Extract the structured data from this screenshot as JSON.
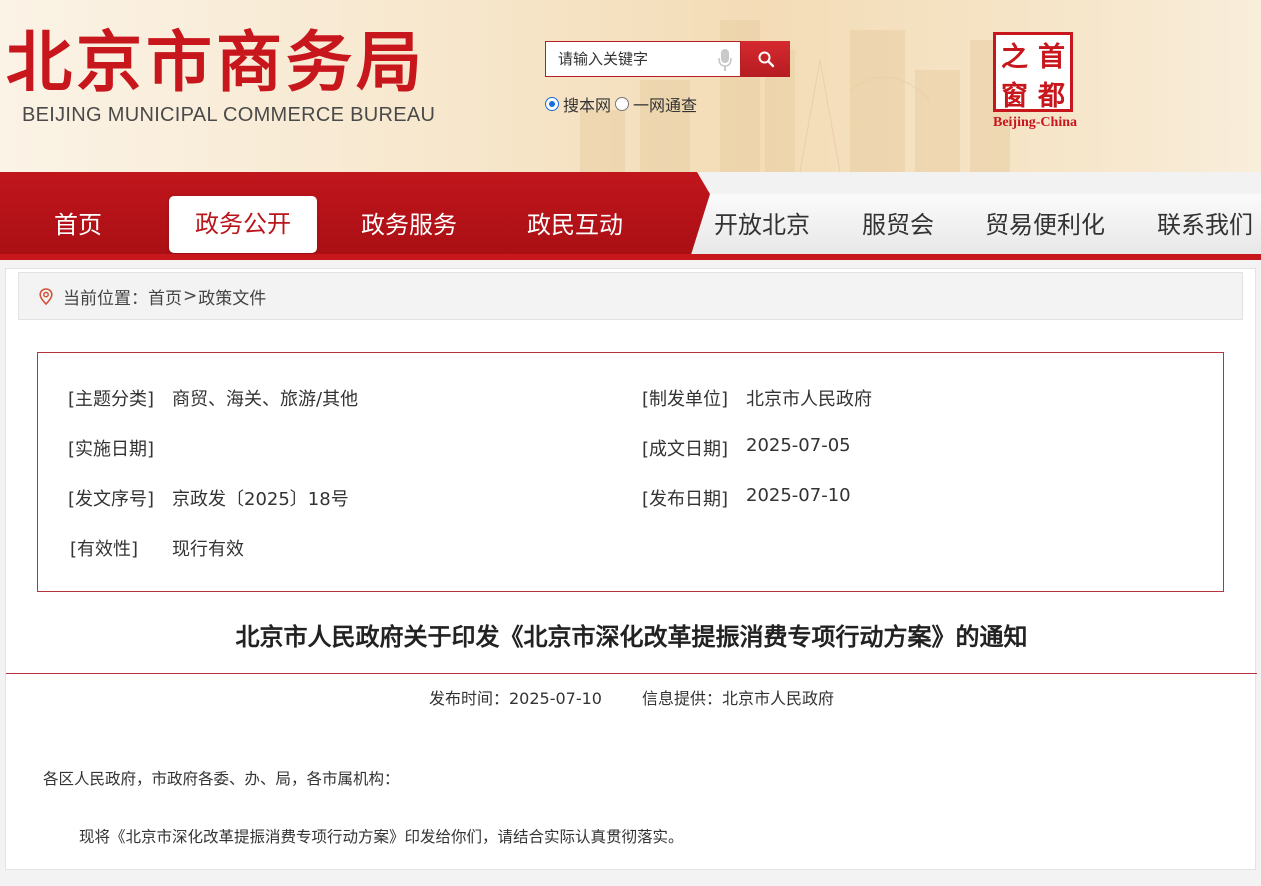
{
  "header": {
    "logo_cn": "北京市商务局",
    "logo_en": "BEIJING MUNICIPAL COMMERCE BUREAU",
    "search": {
      "placeholder": "请输入关键字"
    },
    "scope_options": [
      {
        "label": "搜本网",
        "checked": true
      },
      {
        "label": "一网通查",
        "checked": false
      }
    ],
    "seal": {
      "chars": [
        "之",
        "首",
        "窗",
        "都"
      ],
      "caption": "Beijing-China"
    }
  },
  "nav": {
    "primary": [
      "首页",
      "政务公开",
      "政务服务",
      "政民互动"
    ],
    "active_index": 1,
    "secondary": [
      "开放北京",
      "服贸会",
      "贸易便利化",
      "联系我们"
    ]
  },
  "breadcrumb": {
    "prefix": "当前位置：",
    "items": [
      "首页",
      "政策文件"
    ],
    "separator": ">"
  },
  "meta": {
    "topic": {
      "label": "[主题分类]",
      "value": "商贸、海关、旅游/其他"
    },
    "issuer": {
      "label": "[制发单位]",
      "value": "北京市人民政府"
    },
    "effective_date": {
      "label": "[实施日期]",
      "value": ""
    },
    "written_date": {
      "label": "[成文日期]",
      "value": "2025-07-05"
    },
    "doc_number": {
      "label": "[发文序号]",
      "value": "京政发〔2025〕18号"
    },
    "publish_date": {
      "label": "[发布日期]",
      "value": "2025-07-10"
    },
    "validity": {
      "label": "[有效性]",
      "value": "现行有效"
    }
  },
  "article": {
    "title": "北京市人民政府关于印发《北京市深化改革提振消费专项行动方案》的通知",
    "publish_time": "发布时间：2025-07-10",
    "source": "信息提供：北京市人民政府",
    "salutation": "各区人民政府，市政府各委、办、局，各市属机构：",
    "paragraph1": "现将《北京市深化改革提振消费专项行动方案》印发给你们，请结合实际认真贯彻落实。"
  },
  "colors": {
    "brand_red": "#c8161d",
    "nav_red": "#b51219",
    "border_red": "#b7323a"
  }
}
